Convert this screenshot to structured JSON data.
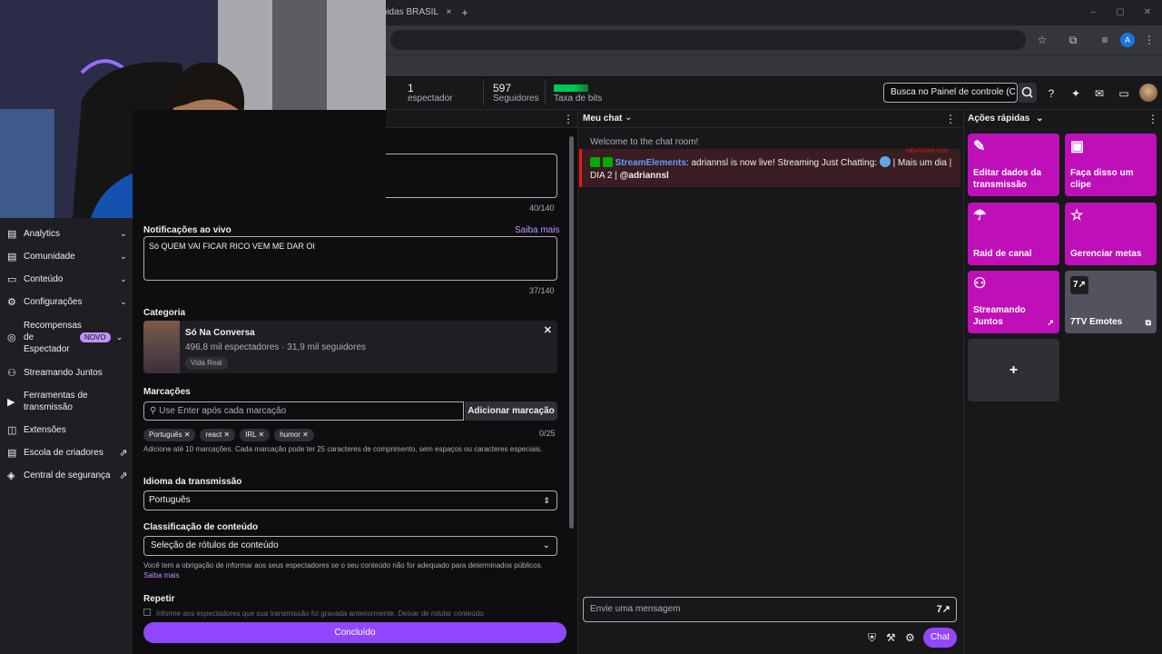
{
  "browser": {
    "tab_title": "midas BRASIL",
    "tab_close": "×",
    "new_tab": "+",
    "window_buttons": [
      "–",
      "▢",
      "✕"
    ],
    "profile_initial": "A"
  },
  "topbar": {
    "viewers_count": "1",
    "viewers_label": "espectador",
    "followers_count": "597",
    "followers_label": "Seguidores",
    "bits_label": "Taxa de bits",
    "search_placeholder": "Busca no Painel de controle (C"
  },
  "sidebar": {
    "items": [
      {
        "icon": "analytics-icon",
        "label": "Analytics",
        "chevron": true
      },
      {
        "icon": "community-icon",
        "label": "Comunidade",
        "chevron": true
      },
      {
        "icon": "content-icon",
        "label": "Conteúdo",
        "chevron": true
      },
      {
        "icon": "settings-icon",
        "label": "Configurações",
        "chevron": true
      },
      {
        "icon": "rewards-icon",
        "label": "Recompensas de Espectador",
        "badge": "NOVO",
        "chevron": true
      },
      {
        "icon": "streaming-together-icon",
        "label": "Streamando Juntos"
      },
      {
        "icon": "tools-icon",
        "label": "Ferramentas de transmissão"
      },
      {
        "icon": "extensions-icon",
        "label": "Extensões"
      },
      {
        "icon": "creator-school-icon",
        "label": "Escola de criadores",
        "external": true
      },
      {
        "icon": "safety-icon",
        "label": "Central de segurança",
        "external": true
      }
    ]
  },
  "stream_info": {
    "title_counter": "40/140",
    "notification_label": "Notificações ao vivo",
    "learn_more": "Saiba mais",
    "notification_value": "Só QUEM VAI FICAR RICO VEM ME DAR OI",
    "notification_counter": "37/140",
    "category_label": "Categoria",
    "category_name": "Só Na Conversa",
    "category_viewers": "496,8 mil espectadores",
    "category_followers": "31,9 mil seguidores",
    "category_tag": "Vida Real",
    "tags_label": "Marcações",
    "tags_placeholder": "Use Enter após cada marcação",
    "add_tag_button": "Adicionar marcação",
    "tags": [
      "Português",
      "react",
      "IRL",
      "humor"
    ],
    "tags_counter": "0/25",
    "tags_hint": "Adicione até 10 marcações. Cada marcação pode ter 25 caracteres de comprimento, sem espaços ou caracteres especiais.",
    "language_label": "Idioma da transmissão",
    "language_value": "Português",
    "classification_label": "Classificação de conteúdo",
    "classification_value": "Seleção de rótulos de conteúdo",
    "classification_hint": "Você tem a obrigação de informar aos seus espectadores se o seu conteúdo não for adequado para determinados públicos.",
    "classification_learn_more": "Saiba mais",
    "repeat_label": "Repetir",
    "repeat_hint": "Informe aos espectadores que sua transmissão foi gravada anteriormente. Deixar de rotular conteúdo",
    "done_button": "Concluído"
  },
  "chat": {
    "header": "Meu chat",
    "welcome": "Welcome to the chat room!",
    "mentions_tag": "MENTIONS YOU",
    "user": "StreamElements",
    "message": ": adriannsl is now live! Streaming Just Chatting:",
    "message_tail": "| Mais um dia | DIA 2 |",
    "mention": "@adriannsl",
    "input_placeholder": "Envie uma mensagem",
    "send_button": "Chat",
    "colors": {
      "user": "#5c9dff",
      "mention_bg": "#3a1d22",
      "mention_border": "#e91916"
    }
  },
  "quick_actions": {
    "header": "Ações rápidas",
    "cards": [
      {
        "icon": "pencil-icon",
        "label": "Editar dados da transmissão",
        "color": "#bf0fb8"
      },
      {
        "icon": "clapper-icon",
        "label": "Faça disso um clipe",
        "color": "#bf0fb8"
      },
      {
        "icon": "raid-icon",
        "label": "Raid de canal",
        "color": "#bf0fb8"
      },
      {
        "icon": "star-icon",
        "label": "Gerenciar metas",
        "color": "#bf0fb8"
      },
      {
        "icon": "add-user-icon",
        "label": "Streamando Juntos",
        "color": "#bf0fb8"
      },
      {
        "icon": "7tv-icon",
        "label": "7TV Emotes",
        "color": "#53535f"
      }
    ],
    "add_label": "+"
  },
  "accent": "#9147ff"
}
